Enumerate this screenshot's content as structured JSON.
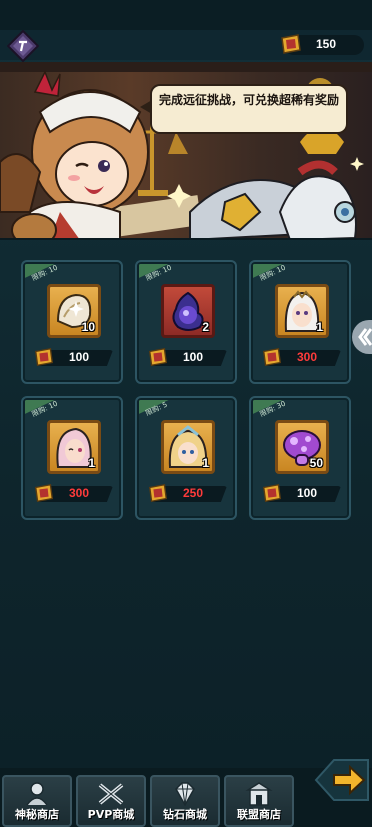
{
  "header": {
    "currency_value": "150",
    "back_icon": "back-diamond-icon"
  },
  "banner": {
    "speech_text": "完成远征挑战，可兑换超稀有奖励"
  },
  "shop_items": [
    {
      "limit": "限购: 10",
      "count": "10",
      "price": "100",
      "price_color": "#ffffff",
      "item_icon": "shell-icon"
    },
    {
      "limit": "限购: 10",
      "count": "2",
      "price": "100",
      "price_color": "#ffffff",
      "item_icon": "purple-flame-orb-icon"
    },
    {
      "limit": "限购: 10",
      "count": "1",
      "price": "300",
      "price_color": "#ff3b3b",
      "item_icon": "hero-white-hair-portrait-icon"
    },
    {
      "limit": "限购: 10",
      "count": "1",
      "price": "300",
      "price_color": "#ff3b3b",
      "item_icon": "hero-pink-hair-portrait-icon"
    },
    {
      "limit": "限购: 5",
      "count": "1",
      "price": "250",
      "price_color": "#ff3b3b",
      "item_icon": "hero-blonde-portrait-icon"
    },
    {
      "limit": "限购: 30",
      "count": "50",
      "price": "100",
      "price_color": "#ffffff",
      "item_icon": "purple-mushroom-icon"
    }
  ],
  "tabs": [
    {
      "label": "神秘商店",
      "icon": "mystery-shop-icon"
    },
    {
      "label": "PVP商城",
      "icon": "pvp-shop-icon"
    },
    {
      "label": "钻石商城",
      "icon": "diamond-shop-icon"
    },
    {
      "label": "联盟商店",
      "icon": "alliance-shop-icon"
    }
  ]
}
